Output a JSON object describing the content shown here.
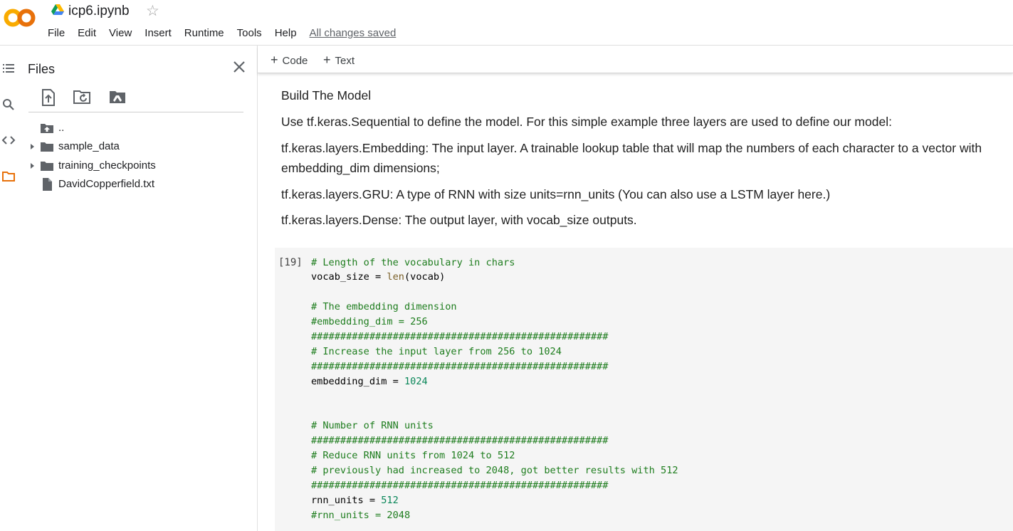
{
  "header": {
    "notebook_title": "icp6.ipynb",
    "star_glyph": "☆",
    "menu": [
      "File",
      "Edit",
      "View",
      "Insert",
      "Runtime",
      "Tools",
      "Help"
    ],
    "save_status": "All changes saved",
    "logo_colors": {
      "left": "#f9ab00",
      "right": "#e8710a"
    }
  },
  "rail": {
    "icons": [
      "table-of-contents-icon",
      "search-icon",
      "code-snippets-icon",
      "folder-icon"
    ],
    "active_color": "#e8710a"
  },
  "files_panel": {
    "title": "Files",
    "toolbar": [
      "upload-icon",
      "refresh-icon",
      "mount-drive-icon"
    ],
    "items": [
      {
        "label": "..",
        "type": "parent"
      },
      {
        "label": "sample_data",
        "type": "folder",
        "expandable": true
      },
      {
        "label": "training_checkpoints",
        "type": "folder",
        "expandable": true
      },
      {
        "label": "DavidCopperfield.txt",
        "type": "file",
        "expandable": false
      }
    ]
  },
  "notebook": {
    "toolbar": {
      "code_label": "Code",
      "text_label": "Text"
    },
    "text_cell": {
      "heading": "Build The Model",
      "intro": "Use tf.keras.Sequential to define the model. For this simple example three layers are used to define our model:",
      "embedding_line1": "tf.keras.layers.Embedding: The input layer. A trainable lookup table that will map the numbers of each character to a vector with",
      "embedding_line2": "embedding_dim dimensions;",
      "gru": "tf.keras.layers.GRU: A type of RNN with size units=rnn_units (You can also use a LSTM layer here.)",
      "dense": "tf.keras.layers.Dense: The output layer, with vocab_size outputs."
    },
    "code_cell": {
      "execution_count": "[19]",
      "l1": "# Length of the vocabulary in chars",
      "l2_a": "vocab_size = ",
      "l2_fn": "len",
      "l2_b": "(vocab)",
      "l4": "# The embedding dimension",
      "l5": "#embedding_dim = 256",
      "l6": "###################################################",
      "l7": "# Increase the input layer from 256 to 1024",
      "l8": "###################################################",
      "l9_a": "embedding_dim = ",
      "l9_num": "1024",
      "l12": "# Number of RNN units",
      "l13": "###################################################",
      "l14": "# Reduce RNN units from 1024 to 512",
      "l15": "# previously had increased to 2048, got better results with 512",
      "l16": "###################################################",
      "l17_a": "rnn_units = ",
      "l17_num": "512",
      "l18": "#rnn_units = 2048"
    }
  }
}
